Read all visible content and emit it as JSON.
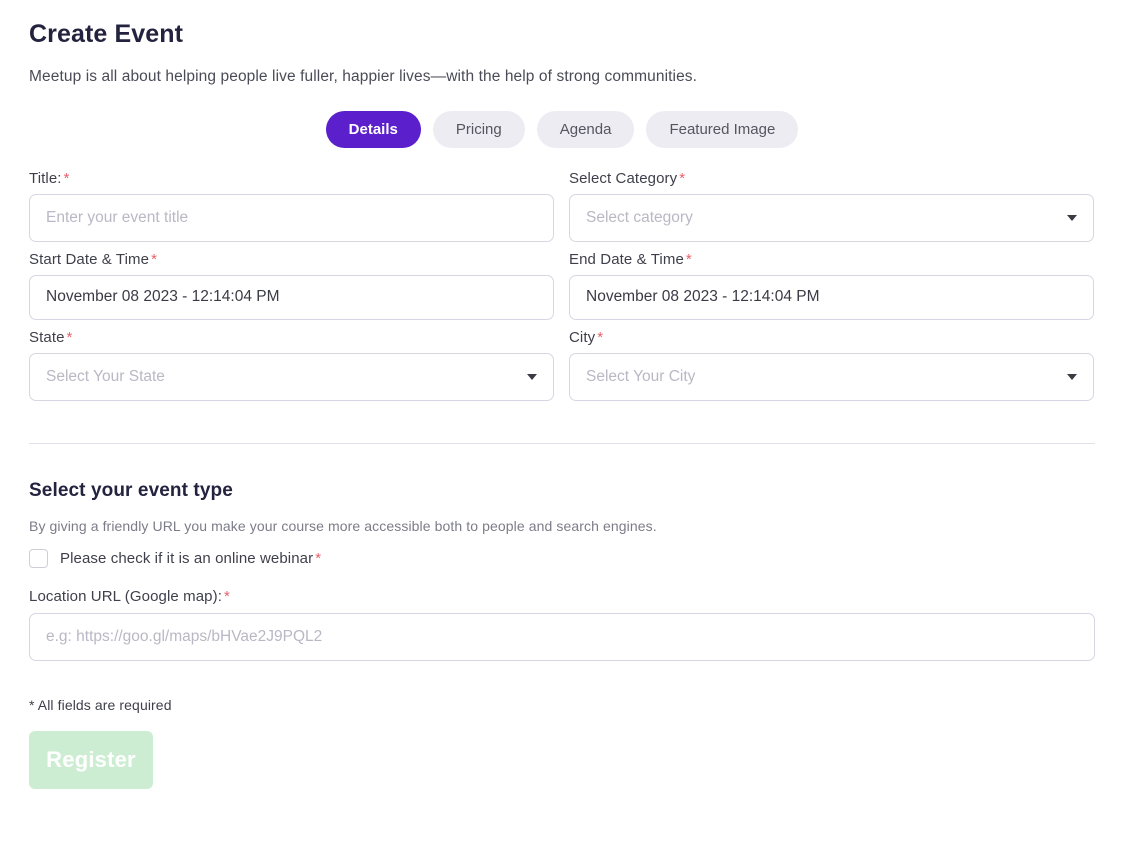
{
  "header": {
    "title": "Create Event",
    "subtitle": "Meetup is all about helping people live fuller, happier lives—with the help of strong communities."
  },
  "tabs": [
    {
      "label": "Details",
      "active": true
    },
    {
      "label": "Pricing",
      "active": false
    },
    {
      "label": "Agenda",
      "active": false
    },
    {
      "label": "Featured Image",
      "active": false
    }
  ],
  "form": {
    "title": {
      "label": "Title:",
      "required": "*",
      "placeholder": "Enter your event title",
      "value": ""
    },
    "category": {
      "label": "Select Category",
      "required": "*",
      "placeholder": "Select category",
      "value": "",
      "caret": "chevron-down-icon"
    },
    "start_date": {
      "label": "Start Date & Time",
      "required": "*",
      "value": "November 08 2023 - 12:14:04 PM"
    },
    "end_date": {
      "label": "End Date & Time",
      "required": "*",
      "value": "November 08 2023 - 12:14:04 PM"
    },
    "state": {
      "label": "State",
      "required": "*",
      "placeholder": "Select Your State",
      "value": "",
      "caret": "chevron-down-icon"
    },
    "city": {
      "label": "City",
      "required": "*",
      "placeholder": "Select Your City",
      "value": "",
      "caret": "chevron-down-icon"
    }
  },
  "event_type": {
    "title": "Select your event type",
    "description": "By giving a friendly URL you make your course more accessible both to people and search engines.",
    "checkbox": {
      "label": "Please check if it is an online webinar",
      "required": "*",
      "checked": false
    },
    "location_url": {
      "label": "Location URL (Google map):",
      "required": "*",
      "placeholder": "e.g: https://goo.gl/maps/bHVae2J9PQL2",
      "value": ""
    }
  },
  "footer": {
    "required_note": "* All fields are required",
    "submit_label": "Register"
  },
  "colors": {
    "accent_purple": "#5b1fcc",
    "tab_inactive": "#eeecf3",
    "required_red": "#e8616d",
    "submit_green": "#cdedd3",
    "border": "#d8d6e3"
  }
}
